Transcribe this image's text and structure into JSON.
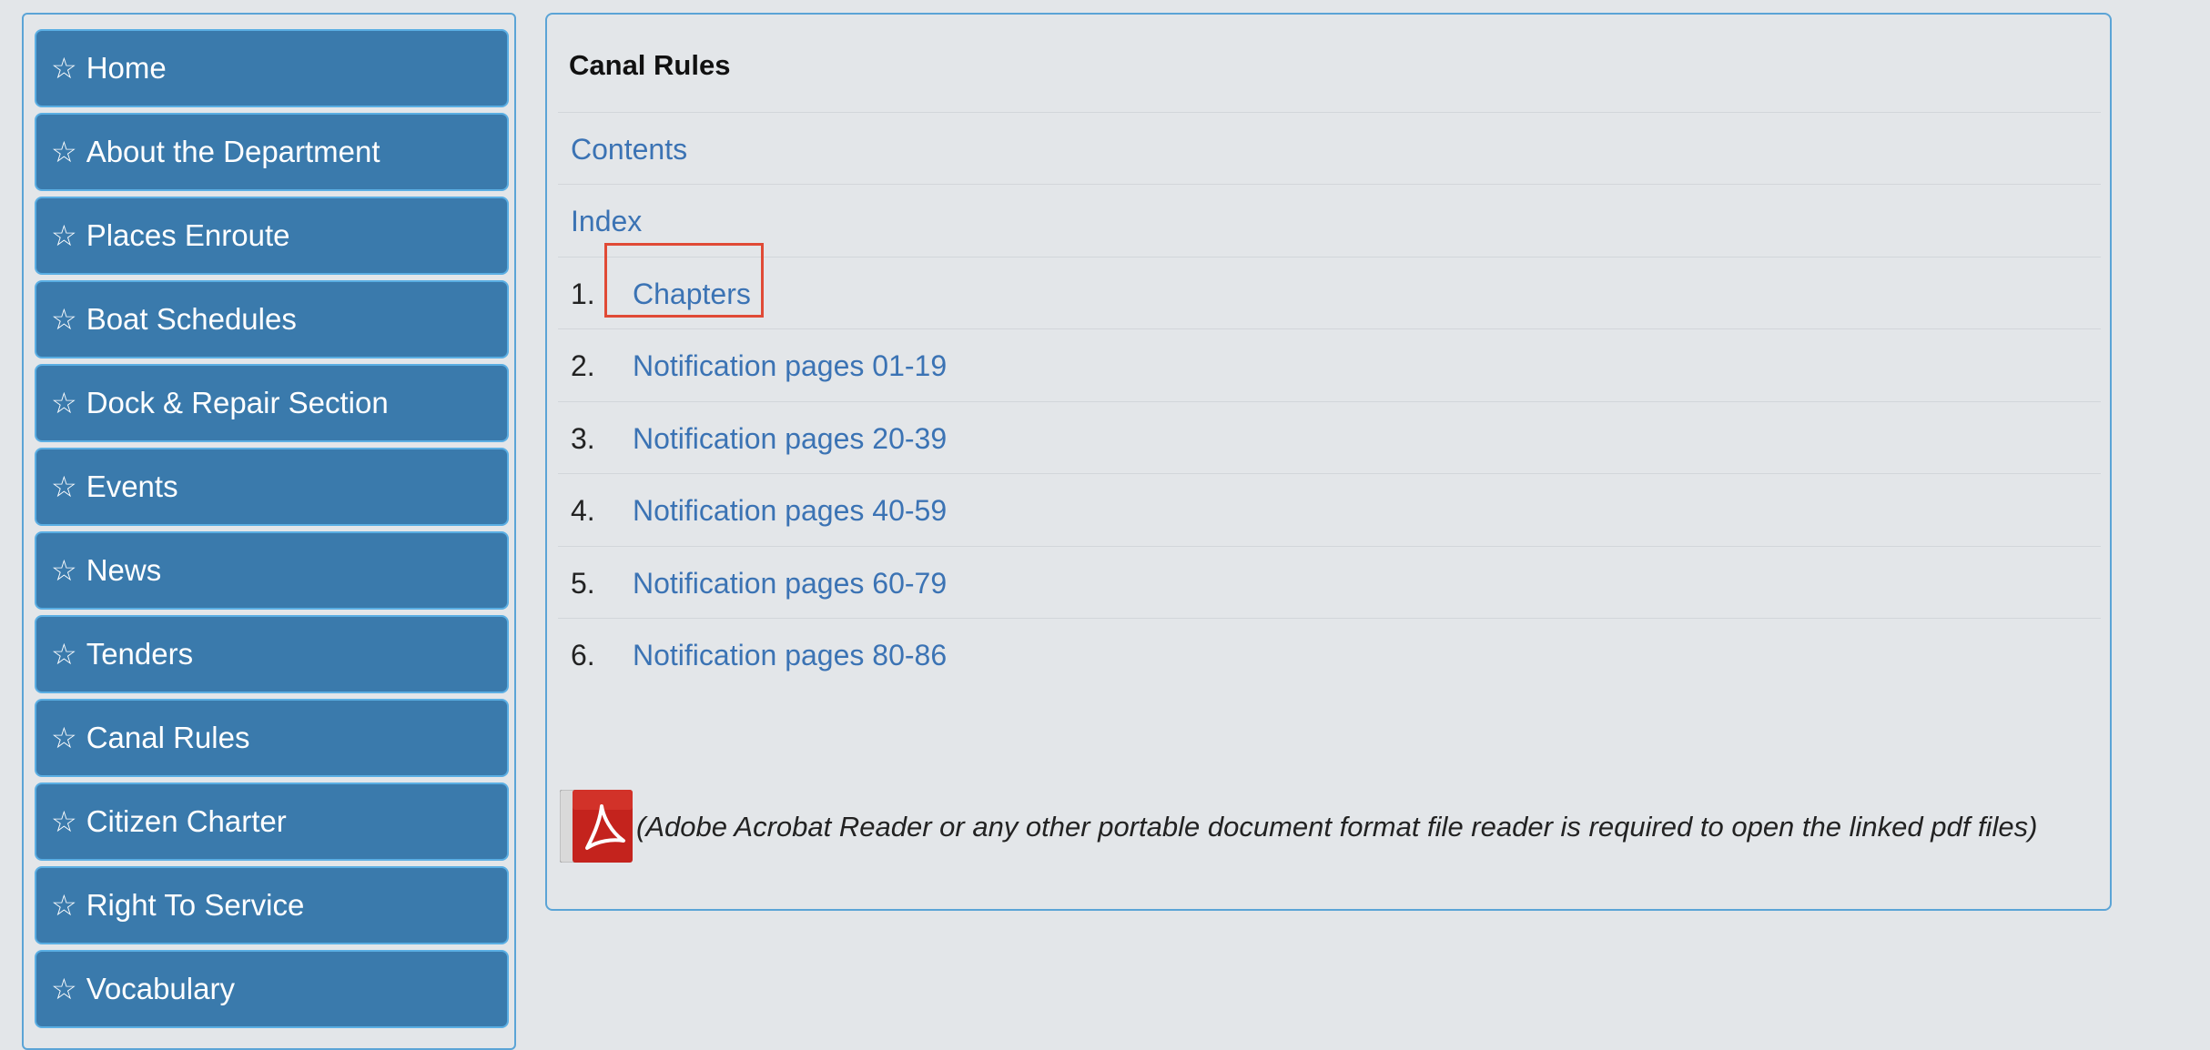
{
  "sidebar": {
    "items": [
      {
        "label": "Home"
      },
      {
        "label": "About the Department"
      },
      {
        "label": "Places Enroute"
      },
      {
        "label": "Boat Schedules"
      },
      {
        "label": "Dock & Repair Section"
      },
      {
        "label": "Events"
      },
      {
        "label": "News"
      },
      {
        "label": "Tenders"
      },
      {
        "label": "Canal Rules"
      },
      {
        "label": "Citizen Charter"
      },
      {
        "label": "Right To Service"
      },
      {
        "label": "Vocabulary"
      }
    ],
    "item_icon": "star-outline-icon",
    "star_glyph": "☆"
  },
  "main": {
    "title": "Canal Rules",
    "links": [
      {
        "label": "Contents"
      },
      {
        "label": "Index"
      }
    ],
    "numbered_links": [
      {
        "num": "1.",
        "label": "Chapters"
      },
      {
        "num": "2.",
        "label": "Notification pages 01-19"
      },
      {
        "num": "3.",
        "label": "Notification pages 20-39"
      },
      {
        "num": "4.",
        "label": "Notification pages 40-59"
      },
      {
        "num": "5.",
        "label": "Notification pages 60-79"
      },
      {
        "num": "6.",
        "label": "Notification pages 80-86"
      }
    ],
    "highlighted_item": "Chapters",
    "pdf_icon": "adobe-pdf-icon",
    "pdf_note": "(Adobe Acrobat Reader or any other portable document format file reader is required to open the linked pdf files)"
  },
  "colors": {
    "background": "#e3e6e9",
    "nav_button": "#3a7aac",
    "nav_border": "#5aaee3",
    "link": "#3b73b4",
    "highlight": "#e04a36"
  }
}
